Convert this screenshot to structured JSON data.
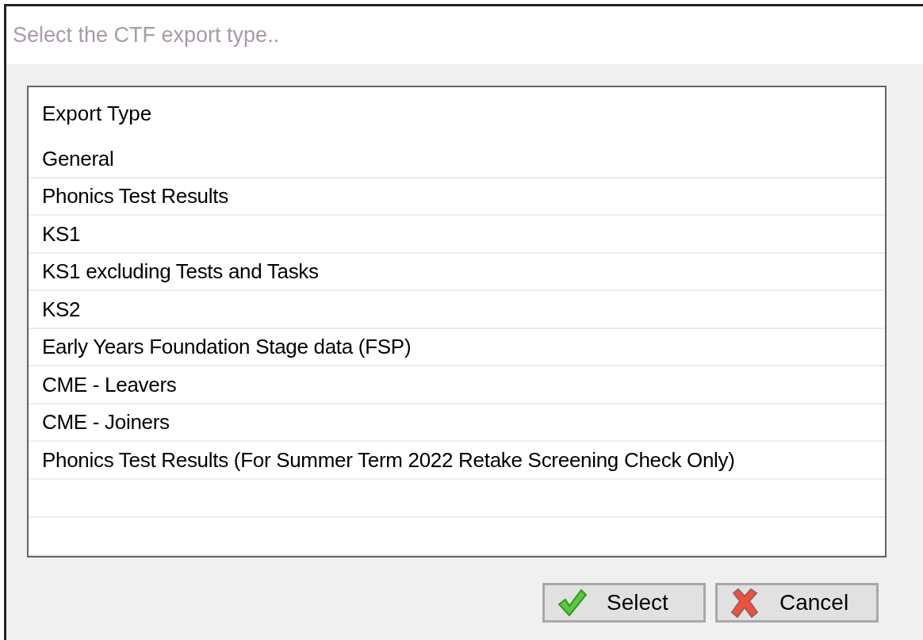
{
  "window": {
    "title": "Select the CTF export type.."
  },
  "list": {
    "column": "Export Type",
    "rows": [
      {
        "label": "General",
        "selected": false
      },
      {
        "label": "Phonics Test Results",
        "selected": false
      },
      {
        "label": "KS1",
        "selected": false
      },
      {
        "label": "KS1 excluding Tests and Tasks",
        "selected": false
      },
      {
        "label": "KS2",
        "selected": false
      },
      {
        "label": "Early Years Foundation Stage data (FSP)",
        "selected": false
      },
      {
        "label": "CME - Leavers",
        "selected": false
      },
      {
        "label": "CME - Joiners",
        "selected": false
      },
      {
        "label": "Phonics Test Results (For Summer Term 2022 Retake Screening Check Only)",
        "selected": false
      }
    ]
  },
  "buttons": [
    {
      "kind": "select",
      "label": "Select"
    },
    {
      "kind": "cancel",
      "label": "Cancel"
    }
  ]
}
